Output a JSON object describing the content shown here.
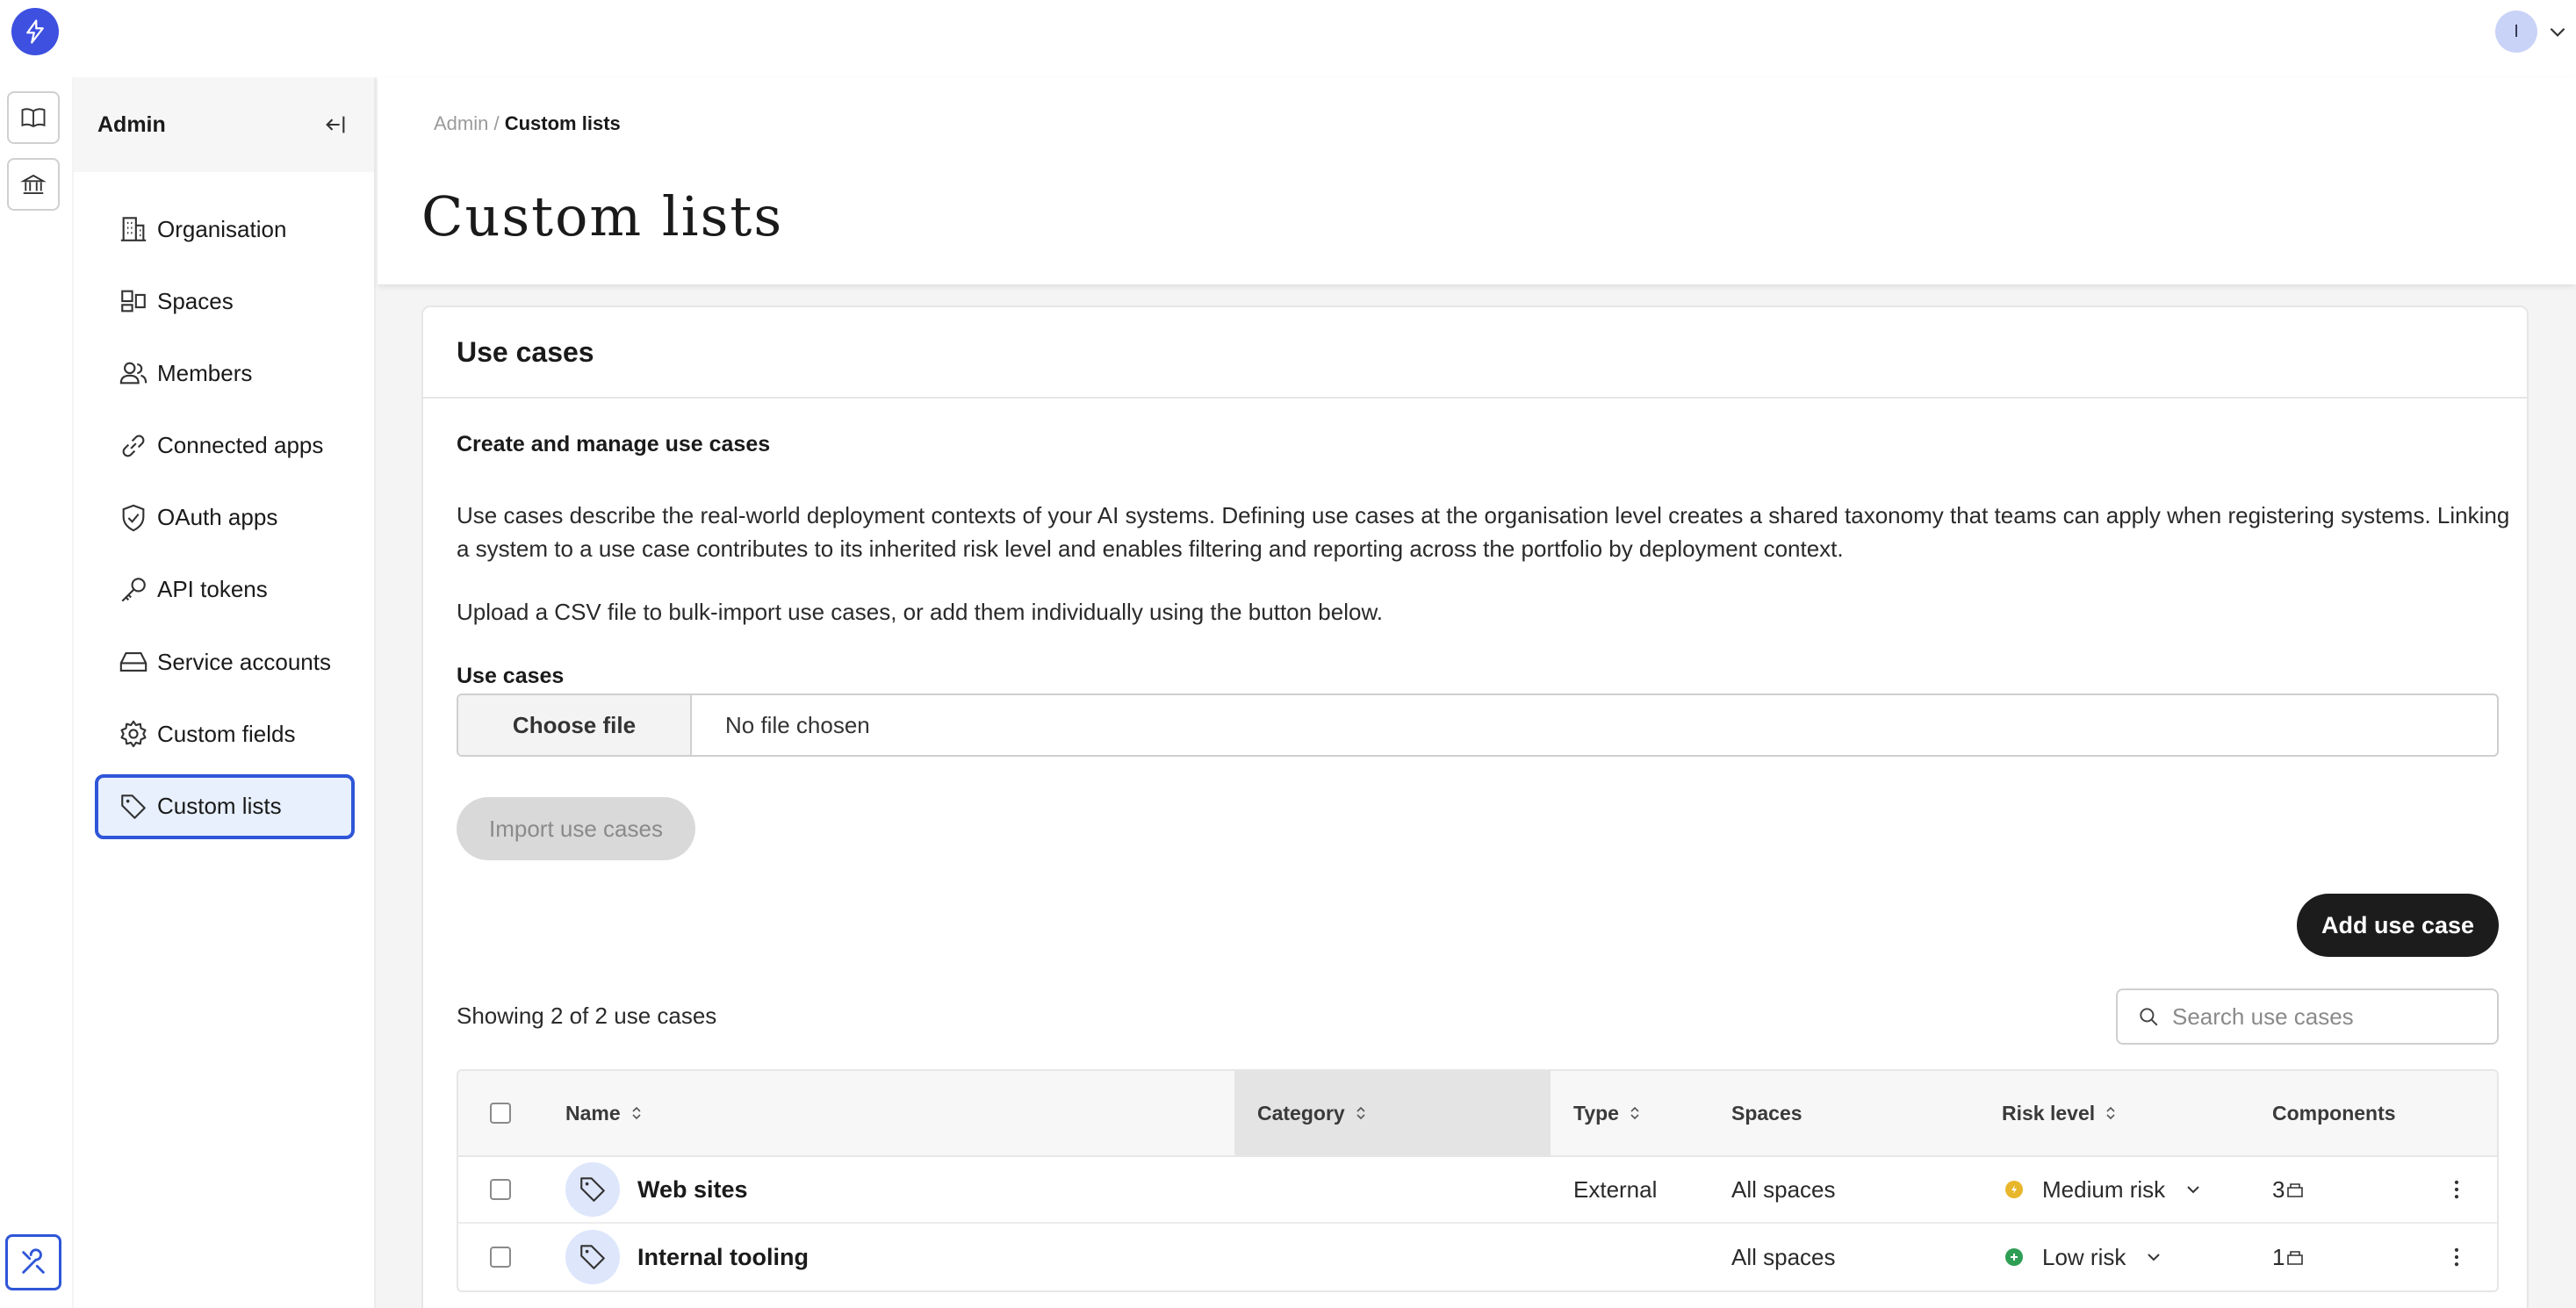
{
  "user": {
    "initial": "I"
  },
  "sidebar": {
    "title": "Admin",
    "items": [
      {
        "label": "Organisation",
        "icon": "building-icon"
      },
      {
        "label": "Spaces",
        "icon": "spaces-icon"
      },
      {
        "label": "Members",
        "icon": "users-icon"
      },
      {
        "label": "Connected apps",
        "icon": "link-icon"
      },
      {
        "label": "OAuth apps",
        "icon": "shield-check-icon"
      },
      {
        "label": "API tokens",
        "icon": "key-icon"
      },
      {
        "label": "Service accounts",
        "icon": "drive-icon"
      },
      {
        "label": "Custom fields",
        "icon": "gear-icon"
      },
      {
        "label": "Custom lists",
        "icon": "tag-icon",
        "active": true
      }
    ]
  },
  "breadcrumb": {
    "parent": "Admin",
    "separator": "/",
    "current": "Custom lists"
  },
  "page": {
    "title": "Custom lists"
  },
  "card": {
    "title": "Use cases",
    "subheading": "Create and manage use cases",
    "description": "Use cases describe the real-world deployment contexts of your AI systems. Defining use cases at the organisation level creates a shared taxonomy that teams can apply when registering systems. Linking a system to a use case contributes to its inherited risk level and enables filtering and reporting across the portfolio by deployment context.",
    "upload_hint": "Upload a CSV file to bulk-import use cases, or add them individually using the button below.",
    "field_label": "Use cases",
    "file_button": "Choose file",
    "file_status": "No file chosen",
    "import_button": "Import use cases",
    "add_button": "Add use case",
    "showing": "Showing 2 of 2 use cases",
    "search_placeholder": "Search use cases"
  },
  "table": {
    "columns": {
      "name": "Name",
      "category": "Category",
      "type": "Type",
      "spaces": "Spaces",
      "risk": "Risk level",
      "components": "Components"
    },
    "rows": [
      {
        "name": "Web sites",
        "category": "",
        "type": "External",
        "spaces": "All spaces",
        "risk": "Medium risk",
        "risk_color": "#e8b62a",
        "components": "3"
      },
      {
        "name": "Internal tooling",
        "category": "",
        "type": "",
        "spaces": "All spaces",
        "risk": "Low risk",
        "risk_color": "#2f9e55",
        "components": "1"
      }
    ]
  },
  "colors": {
    "accent": "#2f56d8",
    "logo": "#3d50e0",
    "primary_button": "#1c1c1c"
  }
}
